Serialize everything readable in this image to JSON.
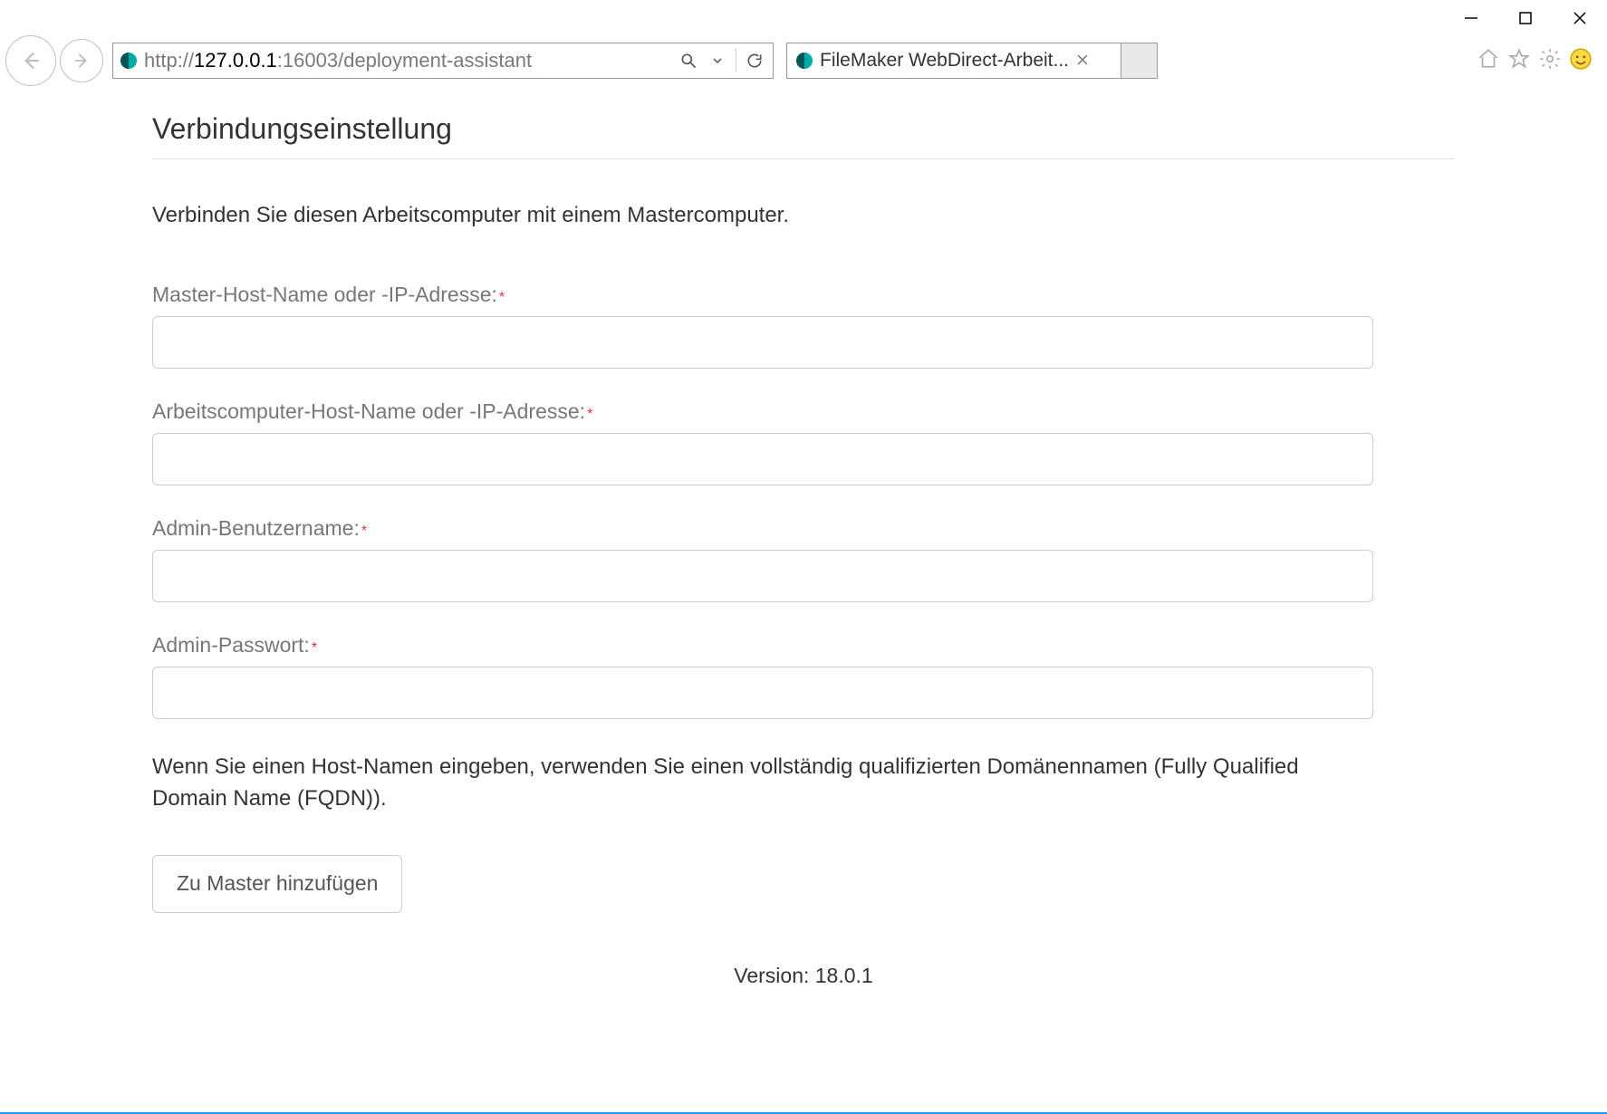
{
  "window": {},
  "toolbar": {
    "url_scheme": "http://",
    "url_host": "127.0.0.1",
    "url_port": ":16003",
    "url_path": "/deployment-assistant"
  },
  "tab": {
    "title": "FileMaker WebDirect-Arbeit..."
  },
  "page": {
    "heading": "Verbindungseinstellung",
    "intro": "Verbinden Sie diesen Arbeitscomputer mit einem Mastercomputer.",
    "fields": {
      "master_host": {
        "label": "Master-Host-Name oder -IP-Adresse:",
        "value": ""
      },
      "worker_host": {
        "label": "Arbeitscomputer-Host-Name oder -IP-Adresse:",
        "value": ""
      },
      "admin_user": {
        "label": "Admin-Benutzername:",
        "value": ""
      },
      "admin_pass": {
        "label": "Admin-Passwort:",
        "value": ""
      }
    },
    "required_mark": "*",
    "hint": "Wenn Sie einen Host-Namen eingeben, verwenden Sie einen vollständig qualifizierten Domänennamen (Fully Qualified Domain Name (FQDN)).",
    "submit_label": "Zu Master hinzufügen",
    "version_label": "Version: 18.0.1"
  }
}
